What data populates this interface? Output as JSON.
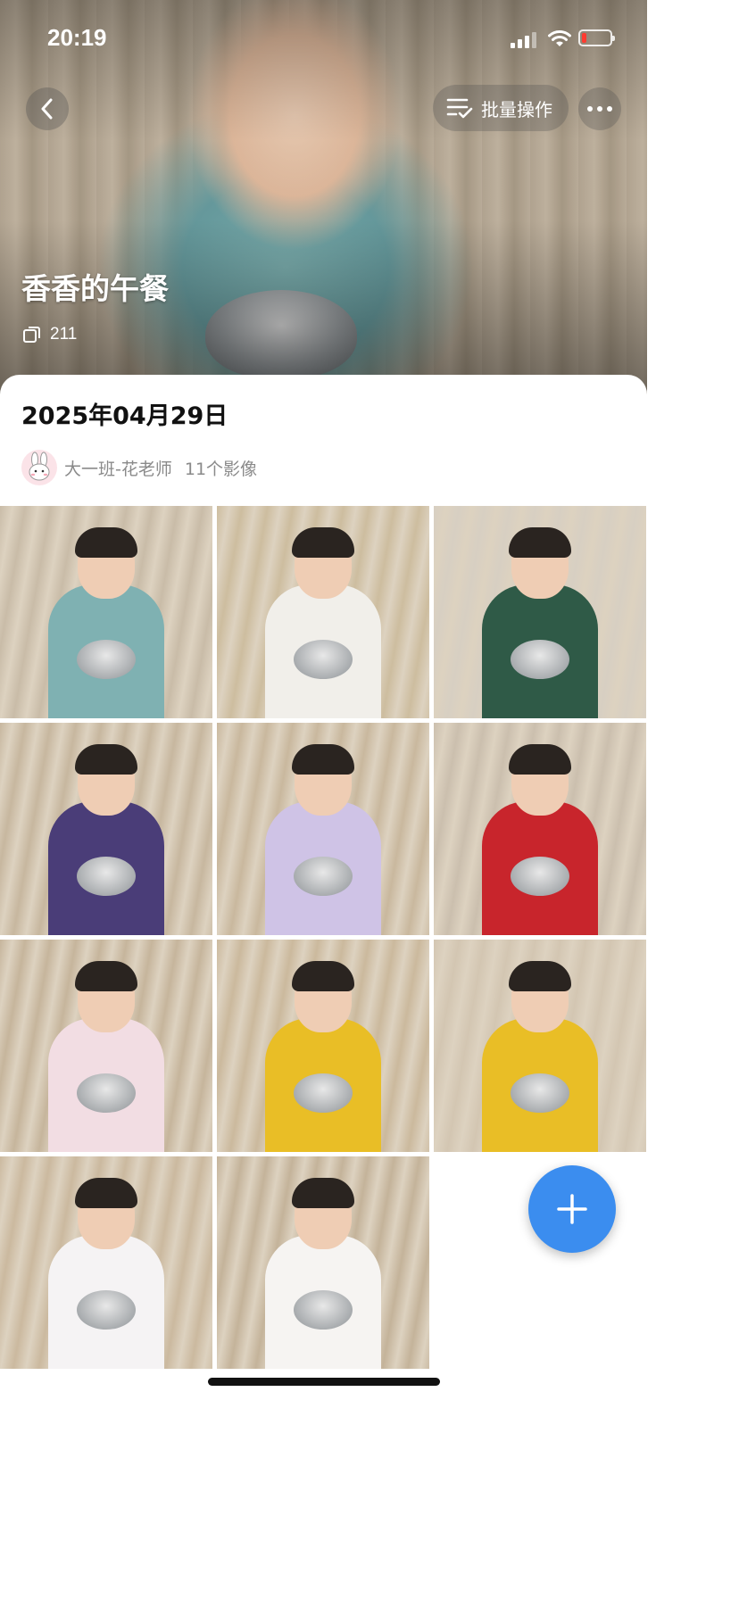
{
  "status_bar": {
    "time": "20:19",
    "battery_level": 0.15
  },
  "header": {
    "batch_label": "批量操作",
    "album_title": "香香的午餐",
    "photo_total": "211"
  },
  "post": {
    "date": "2025年04月29日",
    "author": "大一班-花老师",
    "photo_count": "11个影像"
  },
  "photos": [
    {
      "shirt": "#7fb1b2",
      "floor": "#c9bca8"
    },
    {
      "shirt": "#f1efea",
      "floor": "#cdbd9f"
    },
    {
      "shirt": "#2f5a47",
      "floor": "#d7cfc2"
    },
    {
      "shirt": "#4a3d78",
      "floor": "#c7b79f"
    },
    {
      "shirt": "#cfc3e6",
      "floor": "#c9b89e"
    },
    {
      "shirt": "#c8252c",
      "floor": "#cbbfae"
    },
    {
      "shirt": "#f2dde3",
      "floor": "#c6b59c"
    },
    {
      "shirt": "#e9be26",
      "floor": "#cbb99d"
    },
    {
      "shirt": "#e9be26",
      "floor": "#d3c6b2"
    },
    {
      "shirt": "#f5f3f4",
      "floor": "#cbb99f"
    },
    {
      "shirt": "#f6f4f2",
      "floor": "#c4b39a"
    }
  ],
  "colors": {
    "accent": "#3b8def",
    "battery_low": "#ff3b30",
    "meta_text": "#8a8a8a"
  }
}
